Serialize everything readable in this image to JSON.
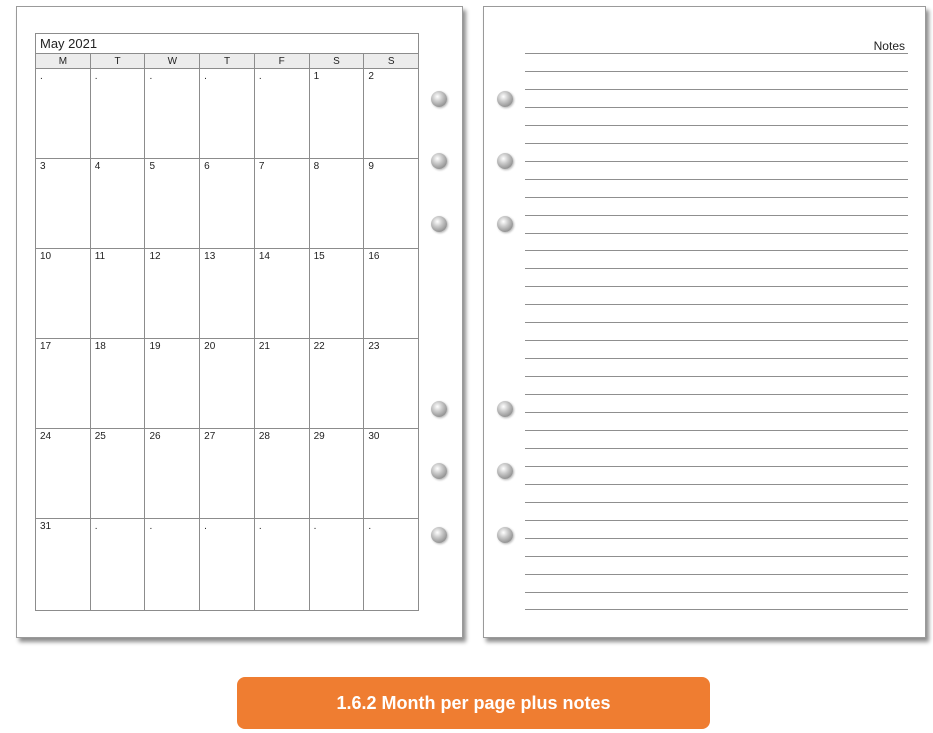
{
  "calendar": {
    "title": "May 2021",
    "weekdays": [
      "M",
      "T",
      "W",
      "T",
      "F",
      "S",
      "S"
    ],
    "weeks": [
      [
        ".",
        ".",
        ".",
        ".",
        ".",
        "1",
        "2"
      ],
      [
        "3",
        "4",
        "5",
        "6",
        "7",
        "8",
        "9"
      ],
      [
        "10",
        "11",
        "12",
        "13",
        "14",
        "15",
        "16"
      ],
      [
        "17",
        "18",
        "19",
        "20",
        "21",
        "22",
        "23"
      ],
      [
        "24",
        "25",
        "26",
        "27",
        "28",
        "29",
        "30"
      ],
      [
        "31",
        ".",
        ".",
        ".",
        ".",
        ".",
        "."
      ]
    ]
  },
  "notes": {
    "title": "Notes"
  },
  "caption": "1.6.2 Month per page plus notes",
  "colors": {
    "caption_bg": "#ef7d31",
    "caption_text": "#ffffff"
  }
}
